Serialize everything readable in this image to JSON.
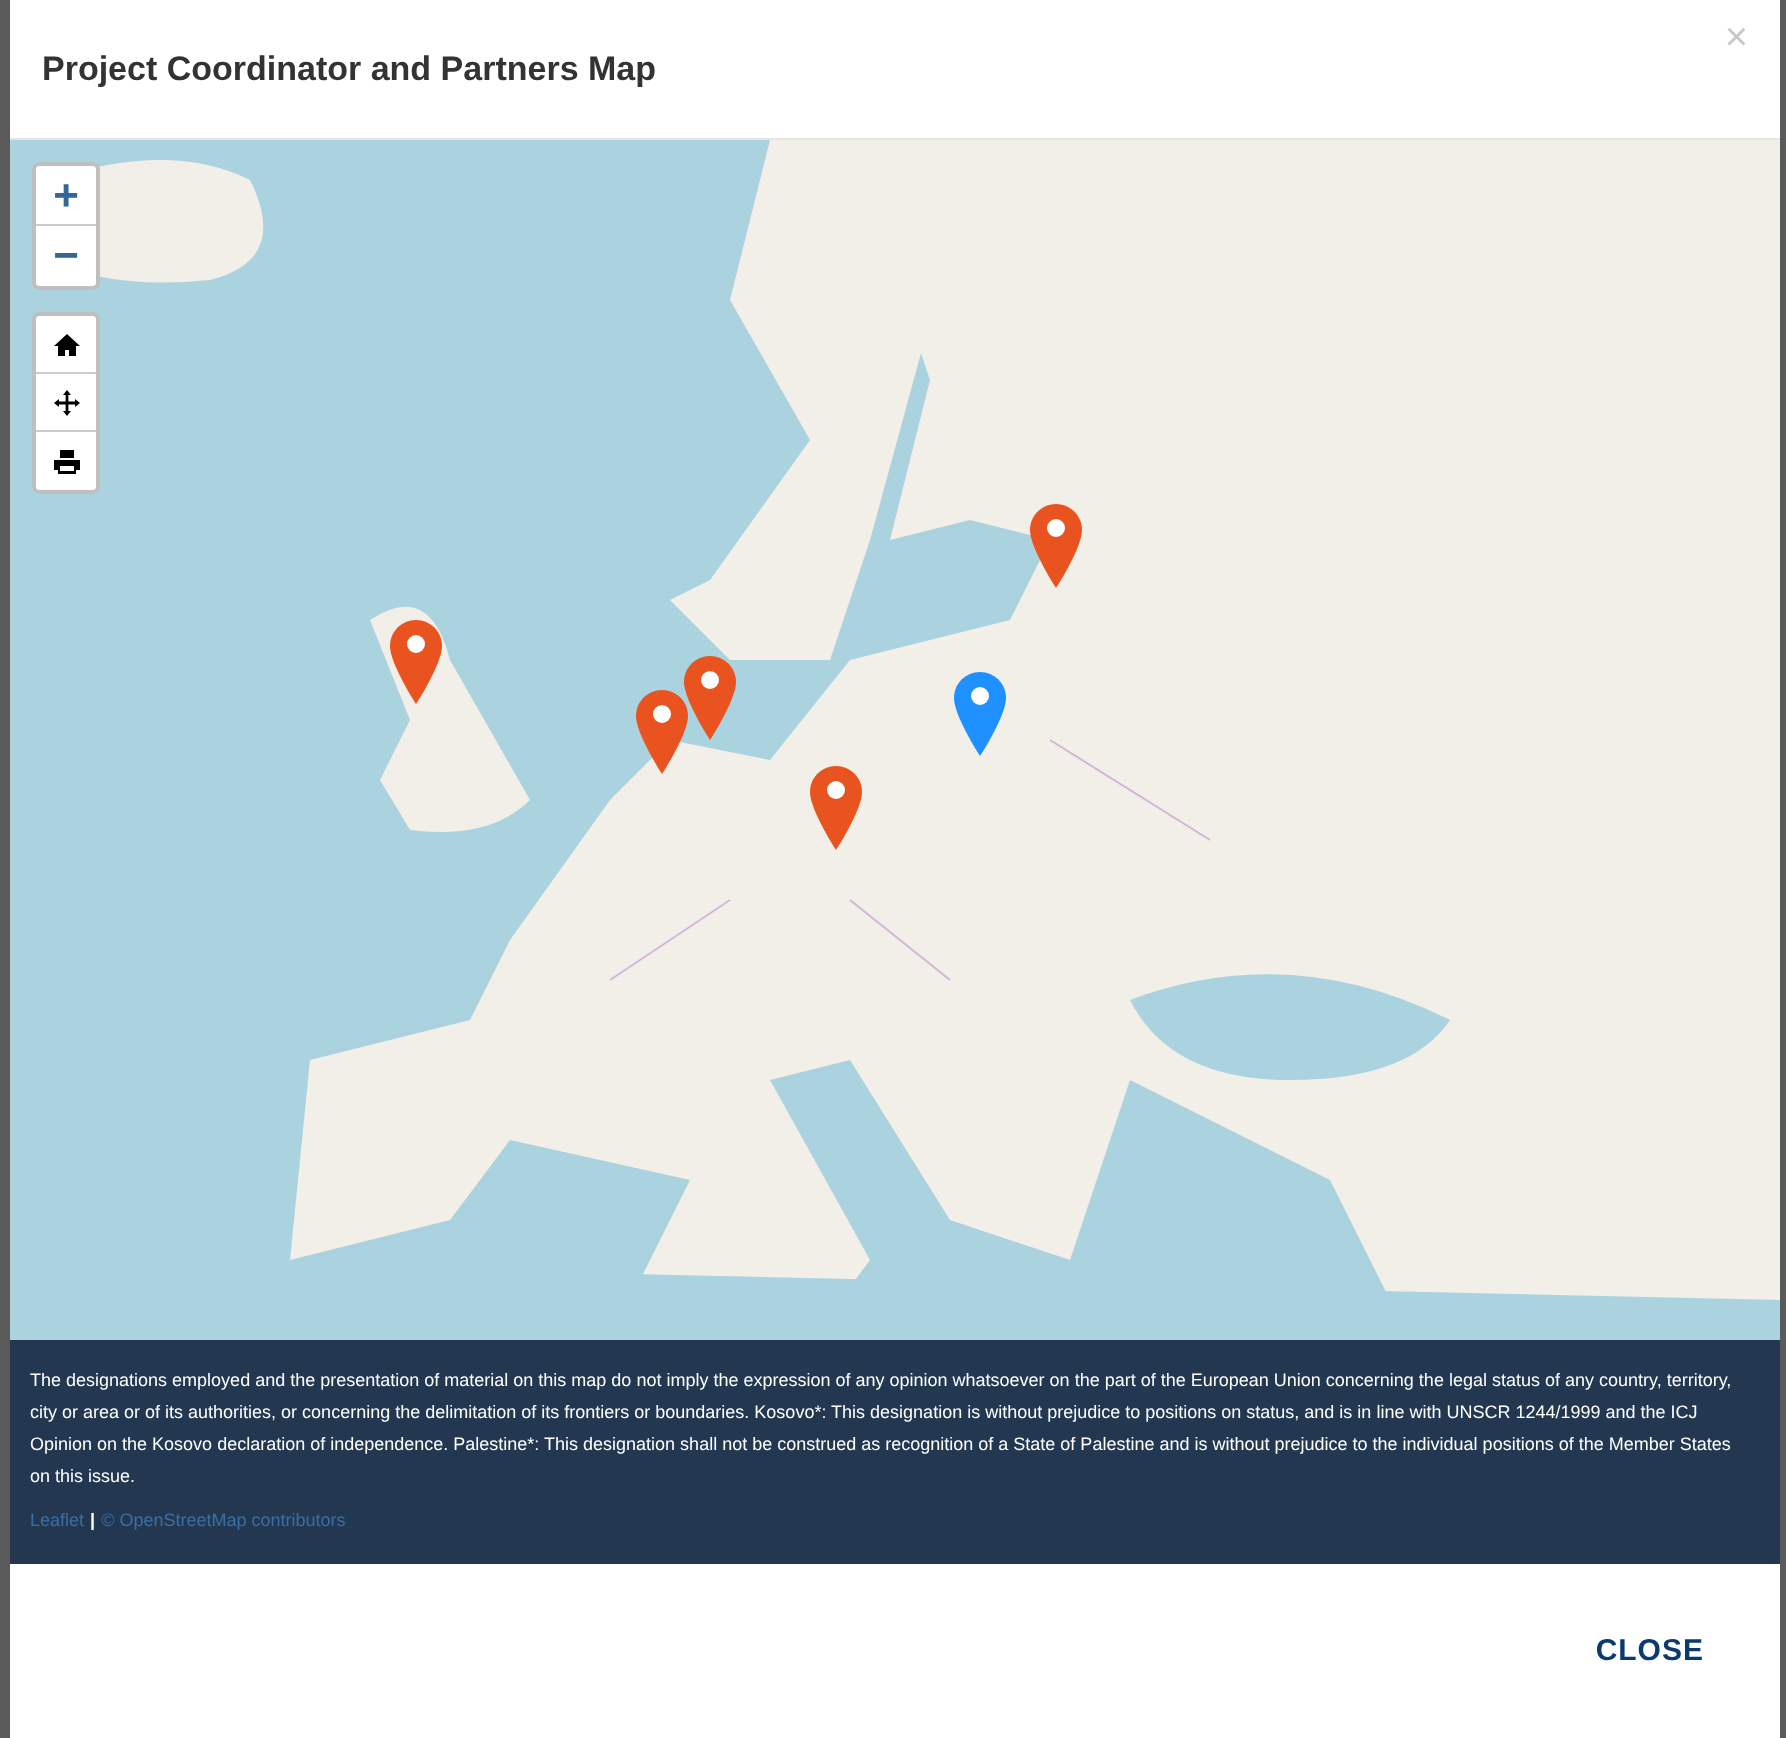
{
  "dialog": {
    "title": "Project Coordinator and Partners Map",
    "close": "×"
  },
  "map": {
    "zoom": [
      "+",
      "−"
    ],
    "tools": [
      {
        "kind": "home"
      },
      {
        "kind": "pan"
      },
      {
        "kind": "print"
      }
    ],
    "markers": [
      {
        "color": "#e8531f"
      },
      {
        "color": "#e8531f"
      },
      {
        "color": "#e8531f"
      },
      {
        "color": "#e8531f"
      },
      {
        "color": "#e8531f"
      },
      {
        "color": "#1e90ff"
      }
    ],
    "disclaimer": "The designations employed and the presentation of material on this map do not imply the expression of any opinion whatsoever on the part of the European Union concerning the legal status of any country, territory, city or area or of its authorities, or concerning the delimitation of its frontiers or boundaries. Kosovo*: This designation is without prejudice to positions on status, and is in line with UNSCR 1244/1999 and the ICJ Opinion on the Kosovo declaration of independence. Palestine*: This designation shall not be construed as recognition of a State of Palestine and is without prejudice to the individual positions of the Member States on this issue.",
    "attribution": {
      "library": "Leaflet",
      "separator": "|",
      "source": "© OpenStreetMap contributors"
    }
  },
  "footer": {
    "button": "CLOSE"
  }
}
